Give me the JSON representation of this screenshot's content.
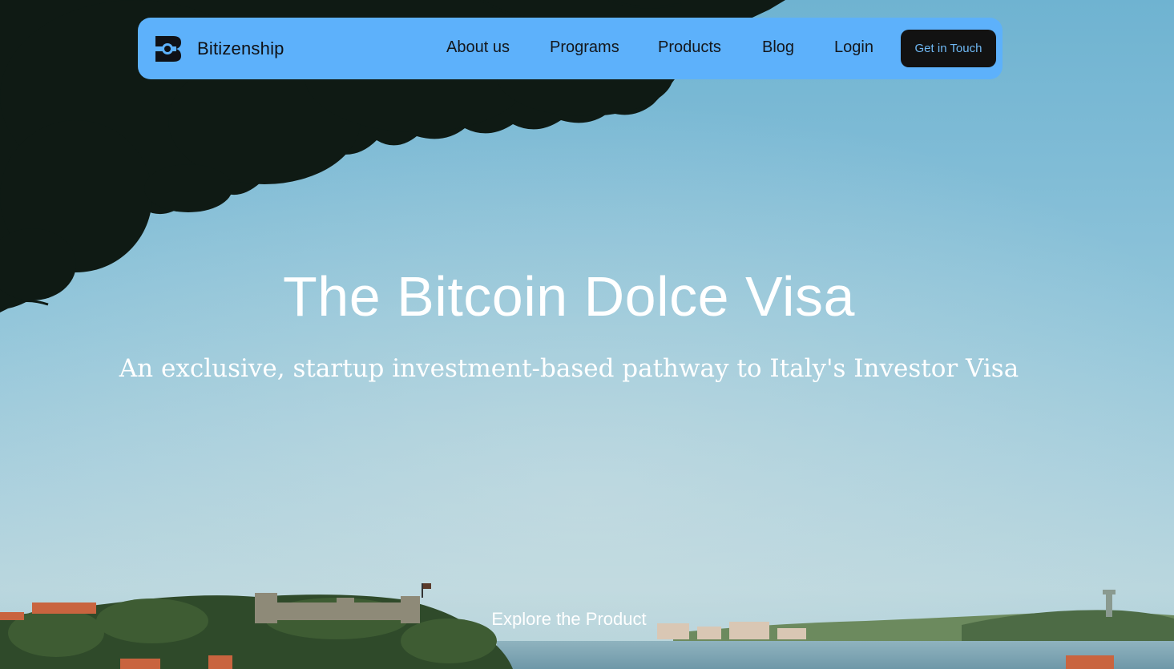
{
  "nav": {
    "brand": "Bitizenship",
    "links": [
      {
        "label": "About us"
      },
      {
        "label": "Programs"
      },
      {
        "label": "Products"
      },
      {
        "label": "Blog"
      },
      {
        "label": "Login"
      }
    ],
    "cta_label": "Get in Touch"
  },
  "hero": {
    "title": "The Bitcoin Dolce Visa",
    "subtitle": "An exclusive, startup investment-based pathway to Italy's Investor Visa",
    "explore_label": "Explore the Product"
  },
  "colors": {
    "nav_background": "#5db1fb",
    "cta_background": "#121212",
    "cta_text": "#6fb8f3",
    "hero_text": "#ffffff"
  },
  "icons": [
    "bitizenship-logo-icon"
  ]
}
